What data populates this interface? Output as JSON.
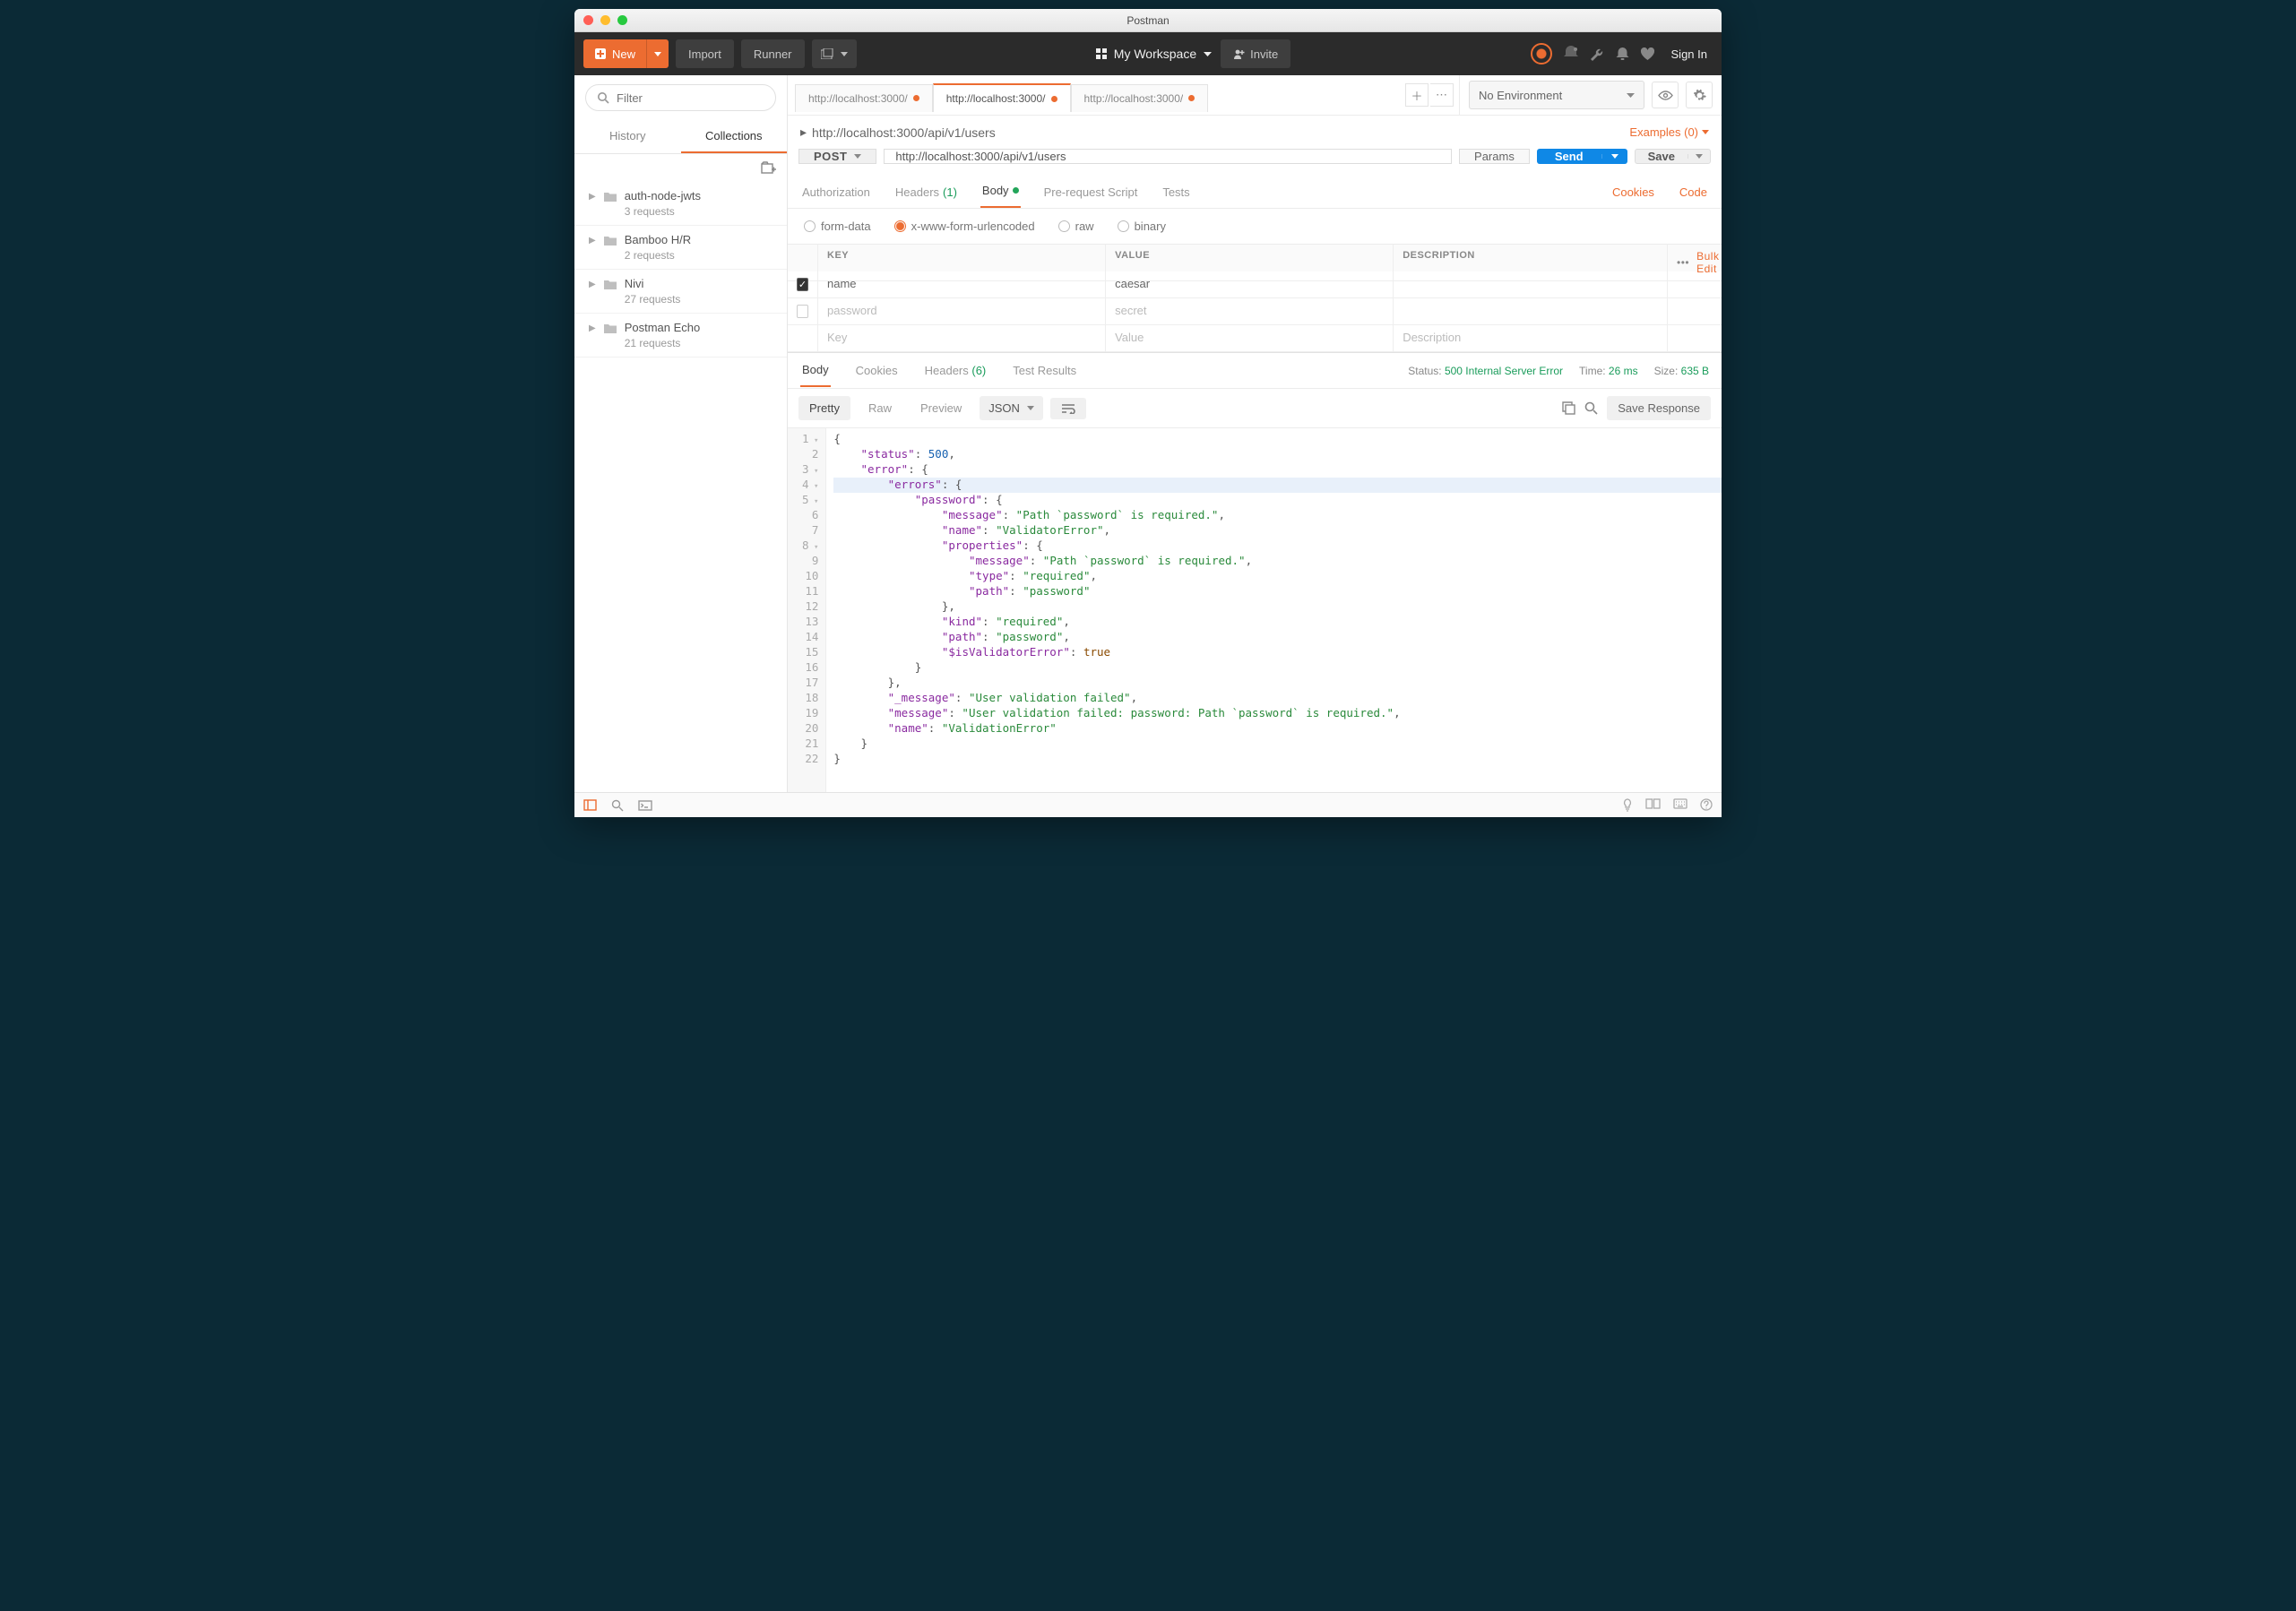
{
  "window": {
    "title": "Postman"
  },
  "topbar": {
    "new": "New",
    "import": "Import",
    "runner": "Runner",
    "workspace": "My Workspace",
    "invite": "Invite",
    "signin": "Sign In"
  },
  "sidebar": {
    "filter_placeholder": "Filter",
    "tabs": {
      "history": "History",
      "collections": "Collections"
    },
    "collections": [
      {
        "name": "auth-node-jwts",
        "sub": "3 requests"
      },
      {
        "name": "Bamboo H/R",
        "sub": "2 requests"
      },
      {
        "name": "Nivi",
        "sub": "27 requests"
      },
      {
        "name": "Postman Echo",
        "sub": "21 requests"
      }
    ]
  },
  "env": {
    "selected": "No Environment"
  },
  "request_tabs": [
    {
      "label": "http://localhost:3000/",
      "dirty": true,
      "active": false
    },
    {
      "label": "http://localhost:3000/",
      "dirty": true,
      "active": true
    },
    {
      "label": "http://localhost:3000/",
      "dirty": true,
      "active": false
    }
  ],
  "crumb": {
    "path": "http://localhost:3000/api/v1/users"
  },
  "examples_link": "Examples (0)",
  "url_row": {
    "method": "POST",
    "url": "http://localhost:3000/api/v1/users",
    "params": "Params",
    "send": "Send",
    "save": "Save"
  },
  "req_subtabs": {
    "authorization": "Authorization",
    "headers": "Headers",
    "headers_count": "(1)",
    "body": "Body",
    "prerequest": "Pre-request Script",
    "tests": "Tests",
    "cookies": "Cookies",
    "code": "Code"
  },
  "body_radios": {
    "formdata": "form-data",
    "xwww": "x-www-form-urlencoded",
    "raw": "raw",
    "binary": "binary"
  },
  "kv": {
    "key_hdr": "KEY",
    "value_hdr": "VALUE",
    "desc_hdr": "DESCRIPTION",
    "bulk": "Bulk Edit",
    "rows": [
      {
        "checked": true,
        "key": "name",
        "value": "caesar"
      },
      {
        "checked": false,
        "key": "password",
        "value": "secret"
      }
    ],
    "placeholders": {
      "key": "Key",
      "value": "Value",
      "desc": "Description"
    }
  },
  "resp": {
    "tabs": {
      "body": "Body",
      "cookies": "Cookies",
      "headers": "Headers",
      "headers_count": "(6)",
      "tests": "Test Results"
    },
    "status_label": "Status:",
    "status": "500 Internal Server Error",
    "time_label": "Time:",
    "time": "26 ms",
    "size_label": "Size:",
    "size": "635 B",
    "views": {
      "pretty": "Pretty",
      "raw": "Raw",
      "preview": "Preview"
    },
    "format": "JSON",
    "save_response": "Save Response"
  },
  "code_lines": [
    "{",
    "    \"status\": 500,",
    "    \"error\": {",
    "        \"errors\": {",
    "            \"password\": {",
    "                \"message\": \"Path `password` is required.\",",
    "                \"name\": \"ValidatorError\",",
    "                \"properties\": {",
    "                    \"message\": \"Path `password` is required.\",",
    "                    \"type\": \"required\",",
    "                    \"path\": \"password\"",
    "                },",
    "                \"kind\": \"required\",",
    "                \"path\": \"password\",",
    "                \"$isValidatorError\": true",
    "            }",
    "        },",
    "        \"_message\": \"User validation failed\",",
    "        \"message\": \"User validation failed: password: Path `password` is required.\",",
    "        \"name\": \"ValidationError\"",
    "    }",
    "}"
  ]
}
